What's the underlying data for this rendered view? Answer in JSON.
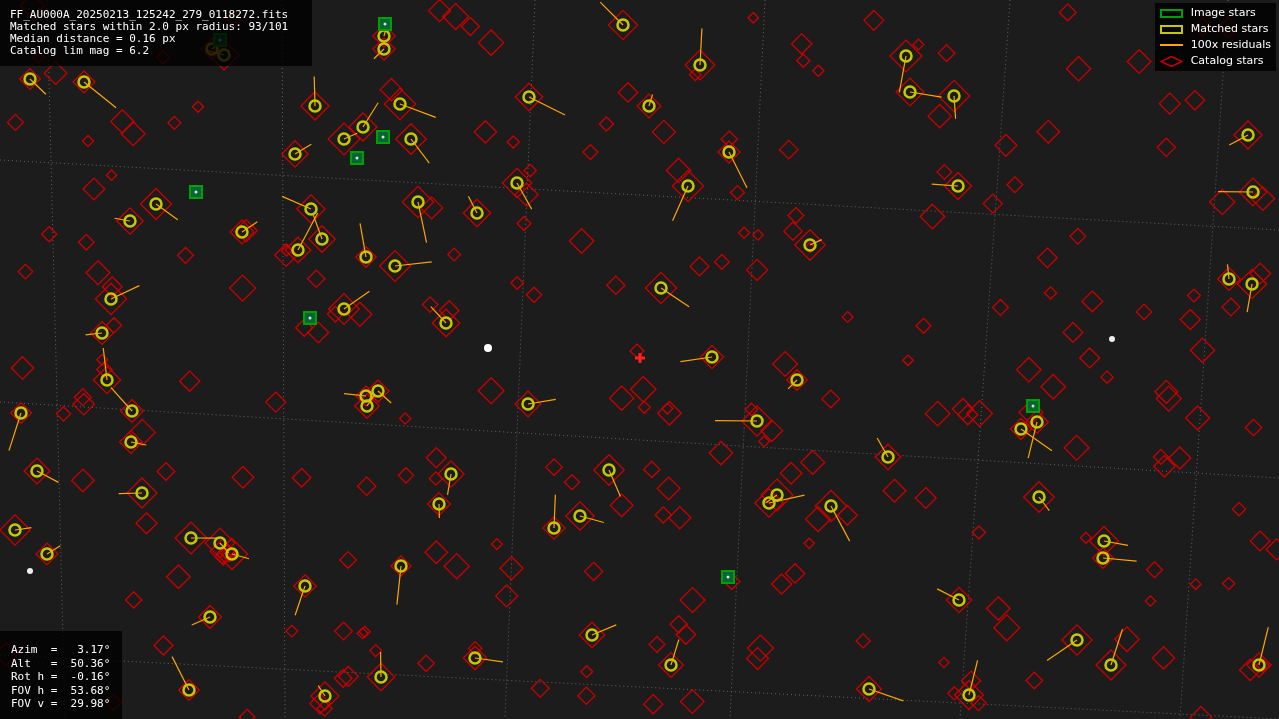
{
  "info": {
    "lines": [
      "FF_AU000A_20250213_125242_279_0118272.fits",
      "Matched stars within 2.0 px radius: 93/101",
      "Median distance = 0.16 px",
      "Catalog lim mag = 6.2"
    ]
  },
  "legend": [
    {
      "kind": "box",
      "label": "Image stars",
      "color": "#00a000"
    },
    {
      "kind": "box",
      "label": "Matched stars",
      "color": "#c8c800"
    },
    {
      "kind": "line",
      "label": "100x residuals",
      "color": "#ffa500"
    },
    {
      "kind": "diamond",
      "label": "Catalog stars",
      "color": "#cc0000"
    }
  ],
  "pointing": {
    "lines": [
      "Azim  =   3.17°",
      "Alt   =  50.36°",
      "Rot h =  -0.16°",
      "FOV h =  53.68°",
      "FOV v =  29.98°"
    ]
  }
}
